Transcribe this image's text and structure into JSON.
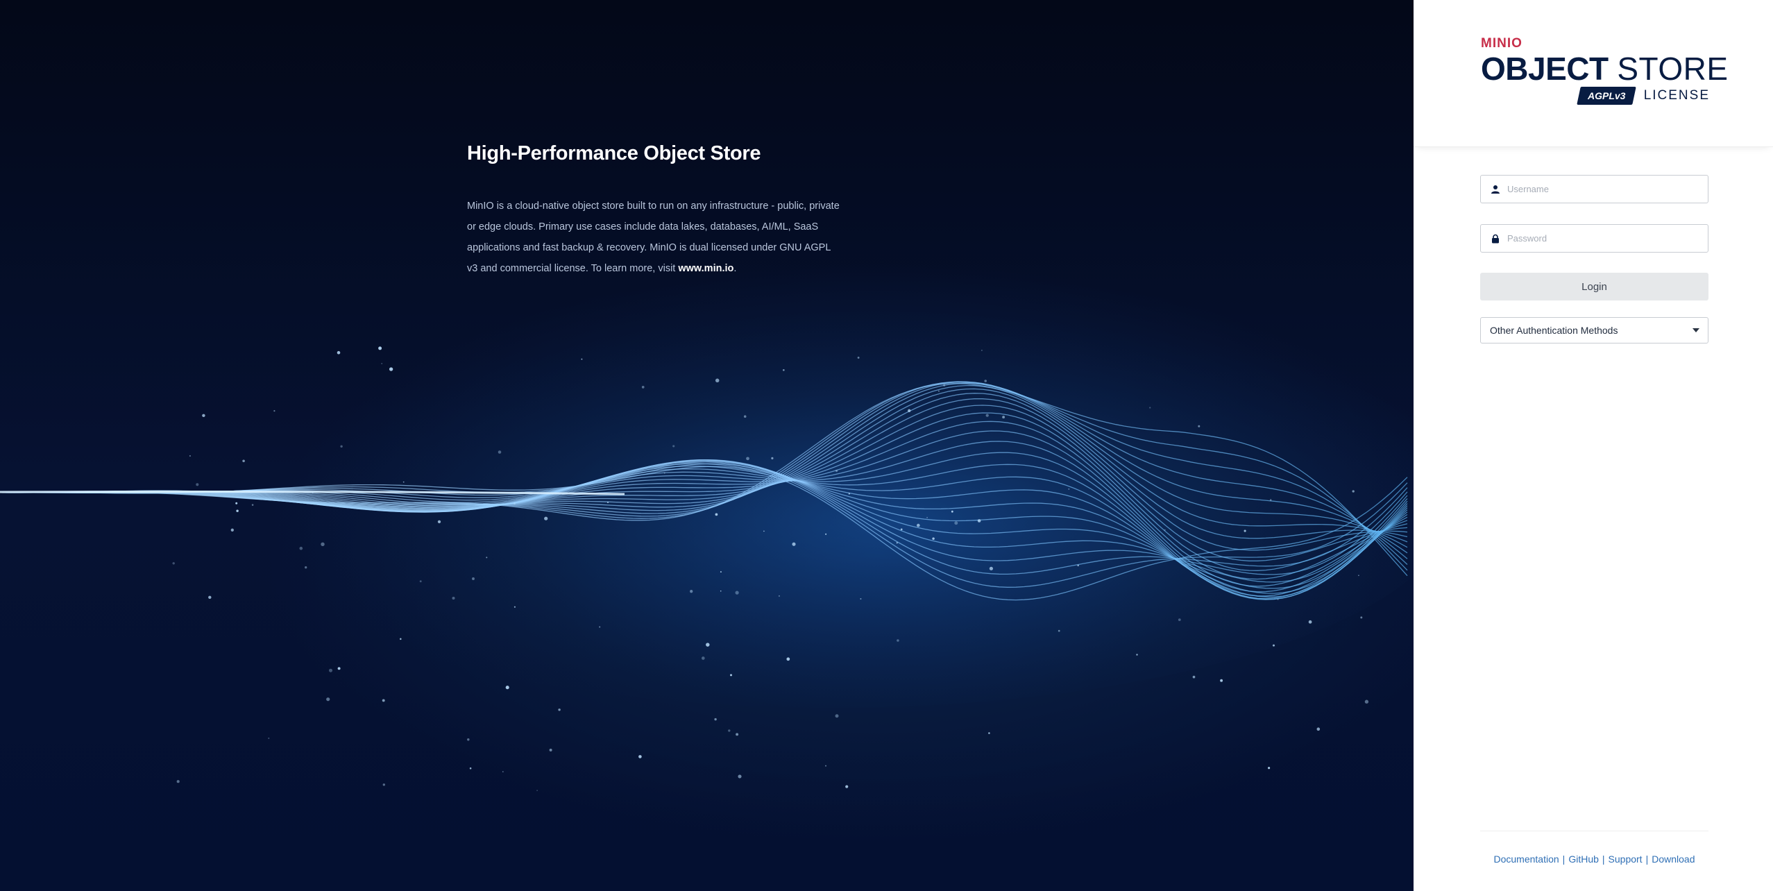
{
  "hero": {
    "title": "High-Performance Object Store",
    "body_text": "MinIO is a cloud-native object store built to run on any infrastructure - public, private or edge clouds. Primary use cases include data lakes, databases, AI/ML, SaaS applications and fast backup & recovery. MinIO is dual licensed under GNU AGPL v3 and commercial license. To learn more, visit ",
    "link_text": "www.min.io",
    "link_suffix": "."
  },
  "brand": {
    "company": "MINIO",
    "product_bold": "OBJECT",
    "product_light": "STORE",
    "badge": "AGPLv3",
    "license": "LICENSE"
  },
  "login": {
    "username_placeholder": "Username",
    "password_placeholder": "Password",
    "login_label": "Login",
    "other_auth_label": "Other Authentication Methods"
  },
  "footer": {
    "links": [
      "Documentation",
      "GitHub",
      "Support",
      "Download"
    ],
    "separator": "|"
  },
  "icons": {
    "username": "user-icon",
    "password": "lock-icon",
    "dropdown": "chevron-down-icon"
  },
  "colors": {
    "brand_red": "#c72e49",
    "brand_navy": "#081c42",
    "link_blue": "#2f6fb5",
    "hero_bg": "#061233"
  }
}
